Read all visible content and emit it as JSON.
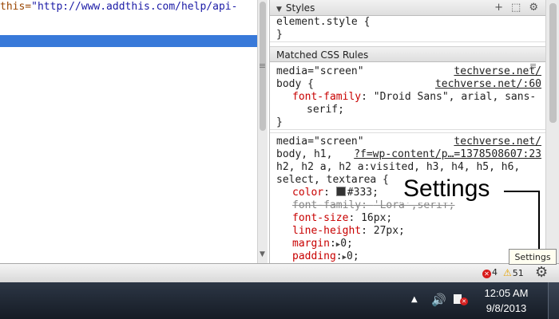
{
  "source": {
    "line_attr": "this=",
    "line_value": "\"http://www.addthis.com/help/api-"
  },
  "styles": {
    "header": "Styles",
    "tools": {
      "add": "+",
      "toggle": "⬚",
      "gear": "⚙"
    },
    "element_style_open": "element.style {",
    "element_style_close": "}",
    "matched_header": "Matched CSS Rules",
    "rule1": {
      "media": "media=\"screen\"",
      "media_src": "techverse.net/",
      "selector": "body {",
      "selector_src": "techverse.net/:60",
      "prop": "font-family",
      "value": "\"Droid Sans\", arial, sans-",
      "value_cont": "serif;",
      "close": "}"
    },
    "rule2": {
      "media": "media=\"screen\"",
      "media_src": "techverse.net/",
      "selector1": "body, h1,",
      "selector1_src": "?f=wp-content/p…=1378508607:23",
      "selector2": "h2, h2 a, h2 a:visited, h3, h4, h5, h6,",
      "selector3": "select, textarea {",
      "props": [
        {
          "name": "color",
          "value": "#333;"
        },
        {
          "name": "font-family",
          "value": "'Lora',serif;"
        },
        {
          "name": "font-size",
          "value": "16px;"
        },
        {
          "name": "line-height",
          "value": "27px;"
        },
        {
          "name": "margin",
          "value": "0;"
        },
        {
          "name": "padding",
          "value": "0;"
        }
      ]
    }
  },
  "annotation": {
    "label": "Settings"
  },
  "tooltip": {
    "label": "Settings"
  },
  "status_bar": {
    "errors": "4",
    "warnings": "51",
    "error_color": "#d81b1b",
    "warning_color": "#e6a300"
  },
  "taskbar": {
    "time": "12:05 AM",
    "date": "9/8/2013"
  },
  "icons": {
    "gear": "gear-icon",
    "speaker": "speaker-icon",
    "network": "network-disconnected-icon",
    "chevron": "chevron-up-icon"
  }
}
